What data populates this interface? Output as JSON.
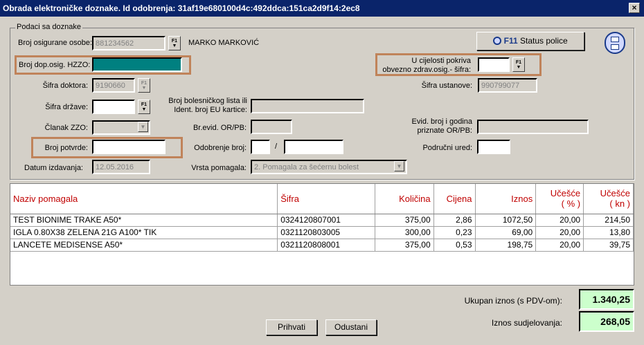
{
  "window": {
    "title": "Obrada elektroničke doznake. Id odobrenja: 31af19e680100d4c:492ddca:151ca2d9f14:2ec8",
    "close": "×"
  },
  "group": {
    "title": "Podaci sa doznake"
  },
  "fields": {
    "broj_osigurane_osobe_label": "Broj osigurane osobe:",
    "broj_osigurane_osobe_value": "881234562",
    "patient_name": "MARKO MARKOVIĆ",
    "broj_dop_label": "Broj dop.osig. HZZO:",
    "broj_dop_value": "",
    "sifra_doktora_label": "Šifra doktora:",
    "sifra_doktora_value": "9190660",
    "sifra_drzave_label": "Šifra države:",
    "sifra_drzave_value": "",
    "clanak_label": "Članak ZZO:",
    "clanak_value": "",
    "broj_potvrde_label": "Broj potvrde:",
    "broj_potvrde_value": "",
    "datum_izdavanja_label": "Datum izdavanja:",
    "datum_izdavanja_value": "12.05.2016",
    "broj_bolesnickog_label_1": "Broj bolesničkog lista ili",
    "broj_bolesnickog_label_2": "Ident. broj EU kartice:",
    "broj_bolesnickog_value": "",
    "brevid_label": "Br.evid. OR/PB:",
    "brevid_value": "",
    "odobrenje_label": "Odobrenje broj:",
    "odobrenje_value_1": "",
    "odobrenje_sep": "/",
    "odobrenje_value_2": "",
    "vrsta_pomagala_label": "Vrsta pomagala:",
    "vrsta_pomagala_value": "2. Pomagala za šećernu bolest",
    "u_cijelosti_label_1": "U cijelosti pokriva",
    "u_cijelosti_label_2": "obvezno zdrav.osig.- šifra:",
    "u_cijelosti_value": "",
    "sifra_ustanove_label": "Šifra ustanove:",
    "sifra_ustanove_value": "990799077",
    "evid_broj_label_1": "Evid. broj i godina",
    "evid_broj_label_2": "priznate OR/PB:",
    "evid_broj_value": "",
    "podrucni_ured_label": "Područni ured:",
    "podrucni_ured_value": ""
  },
  "buttons": {
    "f1_tiny": "F1",
    "status_police_key": "F11",
    "status_police_label": "Status police",
    "prihvati": "Prihvati",
    "odustani": "Odustani"
  },
  "table": {
    "headers": {
      "naziv": "Naziv pomagala",
      "sifra": "Šifra",
      "kolicina": "Količina",
      "cijena": "Cijena",
      "iznos": "Iznos",
      "ucesce_pct_1": "Učešće",
      "ucesce_pct_2": "( % )",
      "ucesce_kn_1": "Učešće",
      "ucesce_kn_2": "( kn )"
    },
    "rows": [
      {
        "naziv": "TEST BIONIME TRAKE A50*",
        "sifra": "0324120807001",
        "kolicina": "375,00",
        "cijena": "2,86",
        "iznos": "1072,50",
        "ucesce_pct": "20,00",
        "ucesce_kn": "214,50"
      },
      {
        "naziv": "IGLA 0.80X38  ZELENA 21G A100*  TIK",
        "sifra": "0321120803005",
        "kolicina": "300,00",
        "cijena": "0,23",
        "iznos": "69,00",
        "ucesce_pct": "20,00",
        "ucesce_kn": "13,80"
      },
      {
        "naziv": "LANCETE MEDISENSE  A50*",
        "sifra": "0321120808001",
        "kolicina": "375,00",
        "cijena": "0,53",
        "iznos": "198,75",
        "ucesce_pct": "20,00",
        "ucesce_kn": "39,75"
      }
    ]
  },
  "totals": {
    "ukupan_label": "Ukupan iznos (s PDV-om):",
    "ukupan_value": "1.340,25",
    "sudjelovanje_label": "Iznos sudjelovanja:",
    "sudjelovanje_value": "268,05"
  },
  "colors": {
    "highlight": "#c0835a",
    "teal_input": "#008080",
    "header_text": "#c00000",
    "total_bg": "#ccffcc"
  }
}
